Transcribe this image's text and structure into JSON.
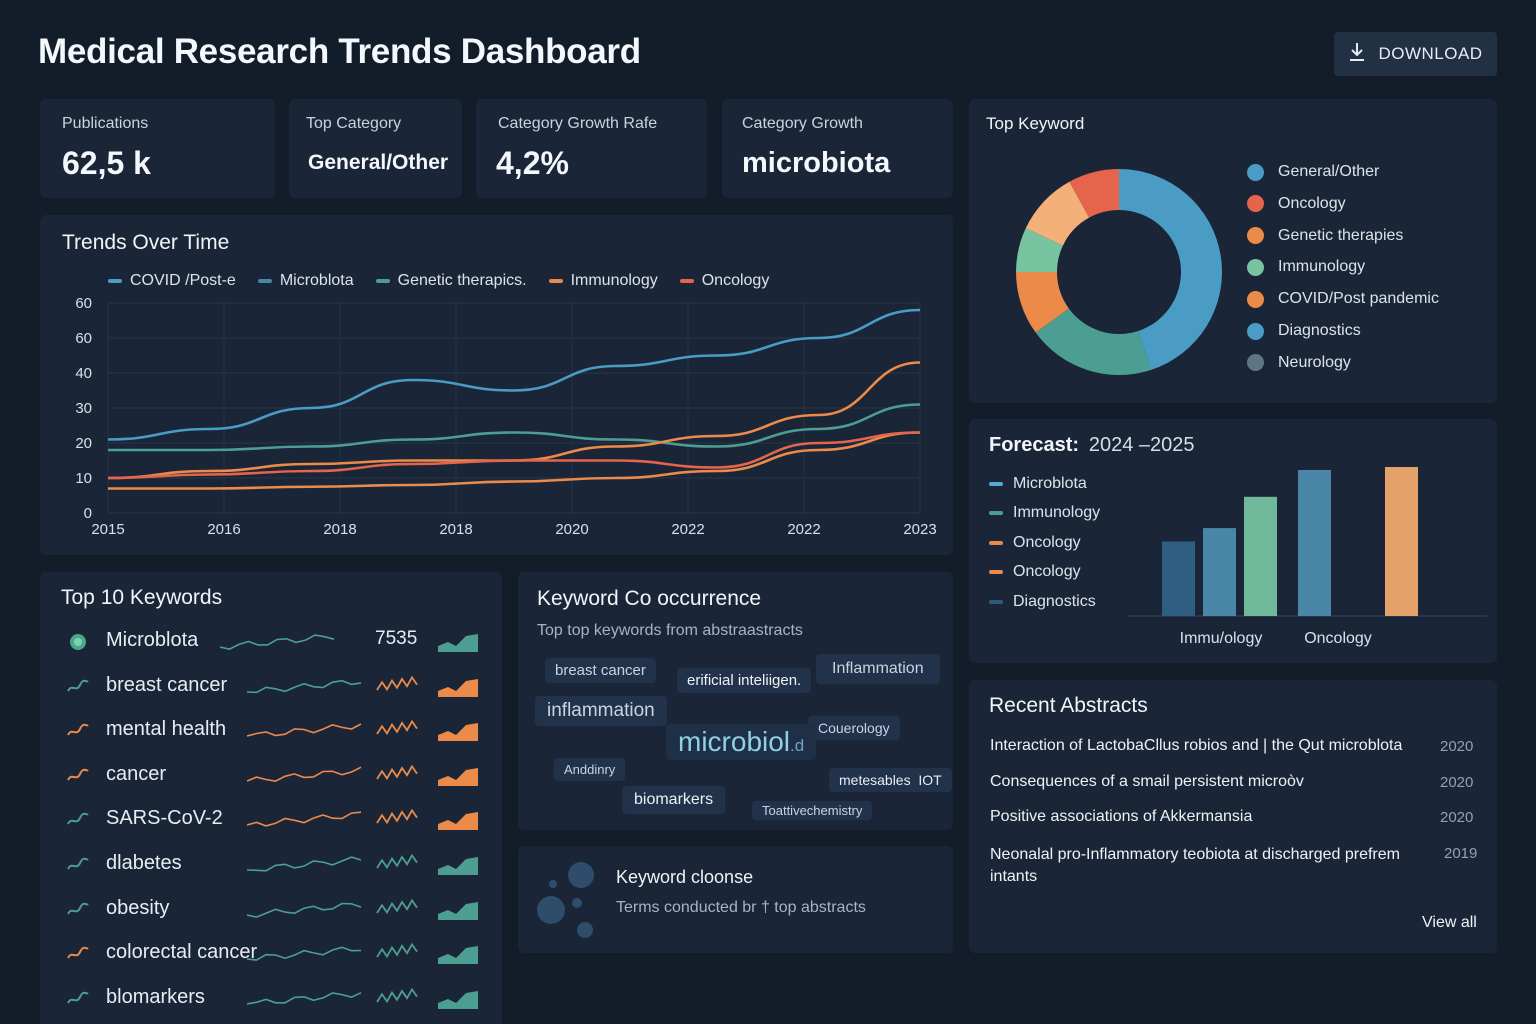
{
  "header": {
    "title": "Medical Research Trends Dashboard",
    "download_label": "DOWNLOAD"
  },
  "kpis": [
    {
      "label": "Publications",
      "value": "62,5 k"
    },
    {
      "label": "Top Category",
      "value": "General/Other"
    },
    {
      "label": "Category Growth Rafe",
      "value": "4,2%"
    },
    {
      "label": "Category Growth",
      "value": "microbiota"
    }
  ],
  "trends": {
    "title": "Trends Over Time",
    "legend": [
      "COVID /Post-e",
      "Microblota",
      "Genetic therapics.",
      "Immunology",
      "Oncology"
    ]
  },
  "top_keyword": {
    "title": "Top Keyword",
    "legend": [
      "General/Other",
      "Oncology",
      "Genetic therapies",
      "Immunology",
      "COVID/Post pandemic",
      "Diagnostics",
      "Neurology"
    ]
  },
  "forecast": {
    "title": "Forecast:",
    "range": "2024 –2025",
    "legend": [
      "Microblota",
      "Immunology",
      "Oncology",
      "Oncology",
      "Diagnostics"
    ]
  },
  "top_keywords": {
    "title": "Top 10 Keywords",
    "items": [
      {
        "name": "Microblota",
        "count": "7535"
      },
      {
        "name": "breast cancer",
        "count": ""
      },
      {
        "name": "mental health",
        "count": ""
      },
      {
        "name": "cancer",
        "count": ""
      },
      {
        "name": "SARS-CoV-2",
        "count": ""
      },
      {
        "name": "dlabetes",
        "count": ""
      },
      {
        "name": "obesity",
        "count": ""
      },
      {
        "name": "colorectal cancer",
        "count": ""
      },
      {
        "name": "blomarkers",
        "count": ""
      }
    ]
  },
  "cooccurrence": {
    "title": "Keyword Co occurrence",
    "subtitle": "Top top keywords from abstraastracts",
    "tags": [
      "breast cancer",
      "erificial inteliigen.",
      "Inflammation",
      "inflammation",
      "Couerology",
      "microbiol",
      ".d",
      "Anddinry",
      "metesables",
      "IOT",
      "biomarkers",
      "Toattivechemistry"
    ]
  },
  "cluster": {
    "title": "Keyword cloonse",
    "subtitle": "Terms conducted br † top abstracts"
  },
  "recent": {
    "title": "Recent Abstracts",
    "items": [
      {
        "text": "Interaction of LactobaCllus robios and | the Qut microblota",
        "year": "2020"
      },
      {
        "text": "Consequences of a smail persistent microòv",
        "year": "2020"
      },
      {
        "text": "Positive associations of Akkermansia",
        "year": "2020"
      },
      {
        "text": "Neonalal pro-Inflammatory teobiota at discharged prefrem intants",
        "year": "2019"
      }
    ],
    "view_all": "View all"
  },
  "colors": {
    "blue": "#4a9cc4",
    "teal": "#4d9e92",
    "orange": "#ec8a4a",
    "red": "#e4644c",
    "green": "#78c4a0",
    "peach": "#f3b079",
    "gray": "#5e7585"
  },
  "chart_data": [
    {
      "type": "line",
      "x": [
        2015,
        2016,
        2017,
        2018,
        2019,
        2020,
        2021,
        2022,
        2023
      ],
      "xticklabels": [
        "2015",
        "2016",
        "2018",
        "2018",
        "2020",
        "2022",
        "2022",
        "2023"
      ],
      "yticklabels": [
        "0",
        "10",
        "20",
        "30",
        "40",
        "60",
        "60"
      ],
      "ylim": [
        0,
        60
      ],
      "series": [
        {
          "name": "COVID /Post-e",
          "values": [
            21,
            24,
            30,
            38,
            35,
            42,
            45,
            50,
            58
          ]
        },
        {
          "name": "Microblota",
          "values": [
            18,
            18,
            19,
            21,
            23,
            21,
            19,
            24,
            31
          ]
        },
        {
          "name": "Genetic therapics.",
          "values": [
            10,
            12,
            14,
            15,
            15,
            19,
            22,
            28,
            43
          ]
        },
        {
          "name": "Immunology",
          "values": [
            7,
            7,
            7.5,
            8,
            9,
            10,
            12,
            18,
            23
          ]
        },
        {
          "name": "Oncology",
          "values": [
            10,
            11,
            12,
            14,
            15,
            15,
            13,
            20,
            23
          ]
        }
      ]
    },
    {
      "type": "pie",
      "labels": [
        "General/Other",
        "Oncology",
        "Genetic therapies",
        "Immunology",
        "COVID/Post pandemic",
        "Diagnostics",
        "Neurology"
      ],
      "values": [
        45,
        8,
        10,
        7,
        10,
        20,
        0
      ]
    },
    {
      "type": "bar",
      "categories": [
        "Immu/ology",
        "Oncology"
      ],
      "series": [
        {
          "name": "Microblota",
          "values": [
            50,
            80
          ]
        },
        {
          "name": "Immunology",
          "values": [
            59,
            98
          ]
        },
        {
          "name": "Oncology",
          "values": [
            80,
            100
          ]
        }
      ]
    }
  ]
}
